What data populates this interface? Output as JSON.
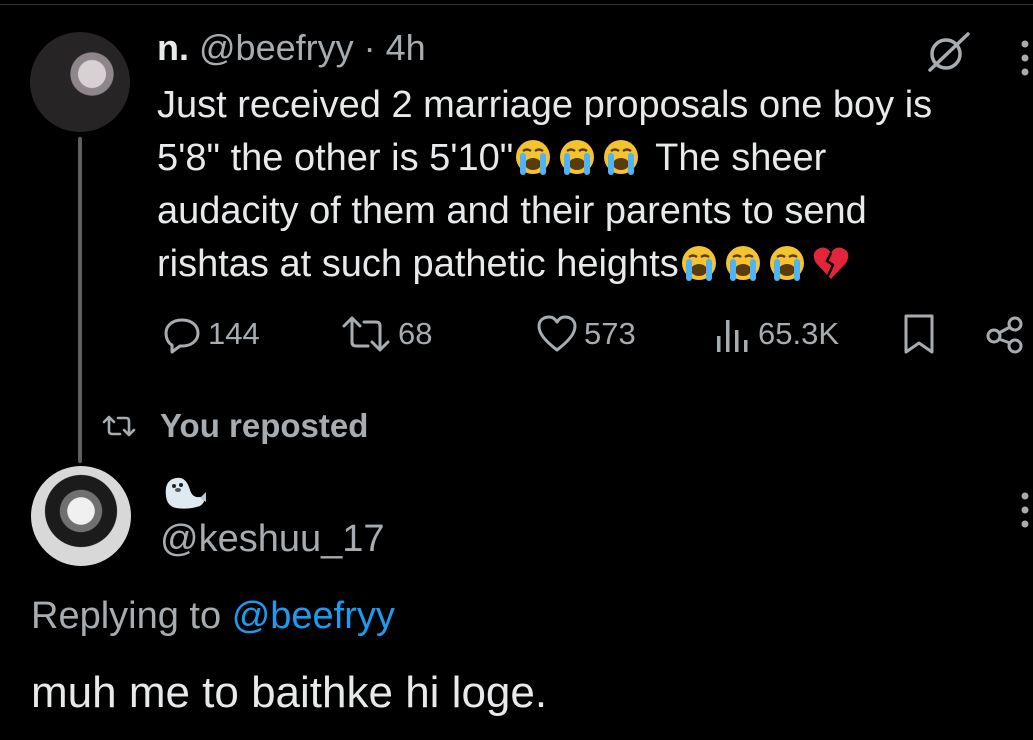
{
  "colors": {
    "background": "#000000",
    "primary_text": "#e7e9ea",
    "secondary_text": "#a7acb1",
    "link": "#1d9bf0",
    "thread_line": "#5b6065"
  },
  "original_tweet": {
    "avatar_icon": "user-avatar-photo",
    "name": "n.",
    "handle": "@beefryy",
    "separator": "·",
    "time": "4h",
    "text_lines": [
      "Just received 2 marriage proposals one boy is",
      "5'8\" the other is 5'10\"",
      "The sheer",
      "audacity of them and their parents to send",
      "rishtas at such pathetic heights"
    ],
    "emojis": {
      "line2": [
        "loudly-crying-face",
        "loudly-crying-face",
        "loudly-crying-face"
      ],
      "line4": [
        "loudly-crying-face",
        "loudly-crying-face",
        "loudly-crying-face",
        "broken-heart"
      ]
    },
    "actions": {
      "replies": "144",
      "reposts": "68",
      "likes": "573",
      "views": "65.3K"
    }
  },
  "repost_banner": {
    "icon": "repost-icon",
    "label": "You reposted"
  },
  "reply_tweet": {
    "avatar_icon": "user-avatar-photo",
    "display_name_emoji": "seal",
    "handle": "@keshuu_17",
    "replying_prefix": "Replying to",
    "replying_to": "@beefryy",
    "text": "muh me to baithke hi loge."
  }
}
